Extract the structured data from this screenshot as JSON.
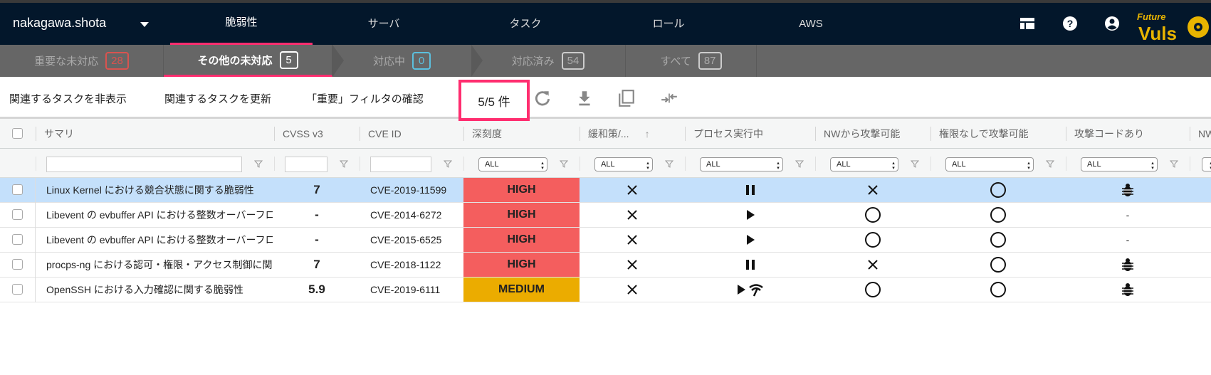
{
  "nav": {
    "user": "nakagawa.shota",
    "items": [
      {
        "label": "脆弱性",
        "active": true
      },
      {
        "label": "サーバ"
      },
      {
        "label": "タスク"
      },
      {
        "label": "ロール"
      },
      {
        "label": "AWS"
      }
    ],
    "icons": [
      "layout-icon",
      "help-icon",
      "account-icon"
    ],
    "logo": "FutureVuls"
  },
  "status_tabs": [
    {
      "label": "重要な未対応",
      "count": "28",
      "color": "#d9534f"
    },
    {
      "label": "その他の未対応",
      "count": "5",
      "color": "#ffffff",
      "active": true
    },
    {
      "label": "対応中",
      "count": "0",
      "color": "#5bc0de"
    },
    {
      "label": "対応済み",
      "count": "54",
      "color": "#cccccc"
    },
    {
      "label": "すべて",
      "count": "87",
      "color": "#cccccc"
    }
  ],
  "toolbar": {
    "hide_tasks": "関連するタスクを非表示",
    "update_tasks": "関連するタスクを更新",
    "check_filter": "「重要」フィルタの確認",
    "count": "5/5 件",
    "icons": [
      "refresh-icon",
      "download-icon",
      "copy-icon",
      "compress-icon"
    ]
  },
  "table": {
    "columns": [
      "サマリ",
      "CVSS v3",
      "CVE ID",
      "深刻度",
      "緩和策/...",
      "プロセス実行中",
      "NWから攻撃可能",
      "権限なしで攻撃可能",
      "攻撃コードあり",
      "NW"
    ],
    "sort_indicator": "↑",
    "filter_select": "ALL",
    "rows": [
      {
        "summary": "Linux Kernel における競合状態に関する脆弱性",
        "cvss": "7",
        "cve": "CVE-2019-11599",
        "severity": "HIGH",
        "mitigation": "x",
        "process": "pause",
        "nw": "x",
        "nopriv": "o",
        "exploit": "bug",
        "selected": true
      },
      {
        "summary": "Libevent の evbuffer API における整数オーバーフロー",
        "cvss": "-",
        "cve": "CVE-2014-6272",
        "severity": "HIGH",
        "mitigation": "x",
        "process": "play",
        "nw": "o",
        "nopriv": "o",
        "exploit": "-"
      },
      {
        "summary": "Libevent の evbuffer API における整数オーバーフロー",
        "cvss": "-",
        "cve": "CVE-2015-6525",
        "severity": "HIGH",
        "mitigation": "x",
        "process": "play",
        "nw": "o",
        "nopriv": "o",
        "exploit": "-"
      },
      {
        "summary": "procps-ng における認可・権限・アクセス制御に関する脆弱性",
        "cvss": "7",
        "cve": "CVE-2018-1122",
        "severity": "HIGH",
        "mitigation": "x",
        "process": "pause",
        "nw": "x",
        "nopriv": "o",
        "exploit": "bug"
      },
      {
        "summary": "OpenSSH における入力確認に関する脆弱性",
        "cvss": "5.9",
        "cve": "CVE-2019-6111",
        "severity": "MEDIUM",
        "mitigation": "x",
        "process": "play-listen",
        "nw": "o",
        "nopriv": "o",
        "exploit": "bug"
      }
    ],
    "severity_colors": {
      "HIGH": "#f45e5e",
      "MEDIUM": "#ebac00"
    },
    "selected_row_color": "#c4e0fb"
  },
  "accent": "#ff2d6f"
}
